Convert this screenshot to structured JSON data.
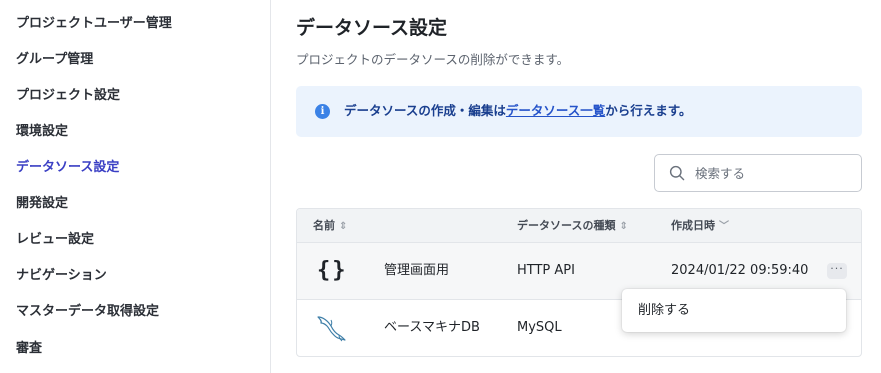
{
  "sidebar": {
    "items": [
      {
        "label": "プロジェクトユーザー管理"
      },
      {
        "label": "グループ管理"
      },
      {
        "label": "プロジェクト設定"
      },
      {
        "label": "環境設定"
      },
      {
        "label": "データソース設定",
        "active": true
      },
      {
        "label": "開発設定"
      },
      {
        "label": "レビュー設定"
      },
      {
        "label": "ナビゲーション"
      },
      {
        "label": "マスターデータ取得設定"
      },
      {
        "label": "審査"
      }
    ]
  },
  "page": {
    "title": "データソース設定",
    "subtitle": "プロジェクトのデータソースの削除ができます。"
  },
  "info": {
    "icon": "info-icon",
    "text_before": "データソースの作成・編集は",
    "link": "データソース一覧",
    "text_after": "から行えます。"
  },
  "search": {
    "placeholder": "検索する",
    "value": ""
  },
  "table": {
    "headers": {
      "name": "名前",
      "type": "データソースの種類",
      "created": "作成日時"
    },
    "rows": [
      {
        "icon": "curly-braces-icon",
        "name": "管理画面用",
        "type": "HTTP API",
        "created": "2024/01/22 09:59:40"
      },
      {
        "icon": "mysql-dolphin-icon",
        "name": "ベースマキナDB",
        "type": "MySQL",
        "created": ""
      }
    ],
    "more_label": "···"
  },
  "menu": {
    "delete_label": "削除する"
  },
  "colors": {
    "accent": "#3a3fc4",
    "info_bg": "#ebf3fd",
    "info_icon": "#3b82e6",
    "link": "#2553c9"
  }
}
